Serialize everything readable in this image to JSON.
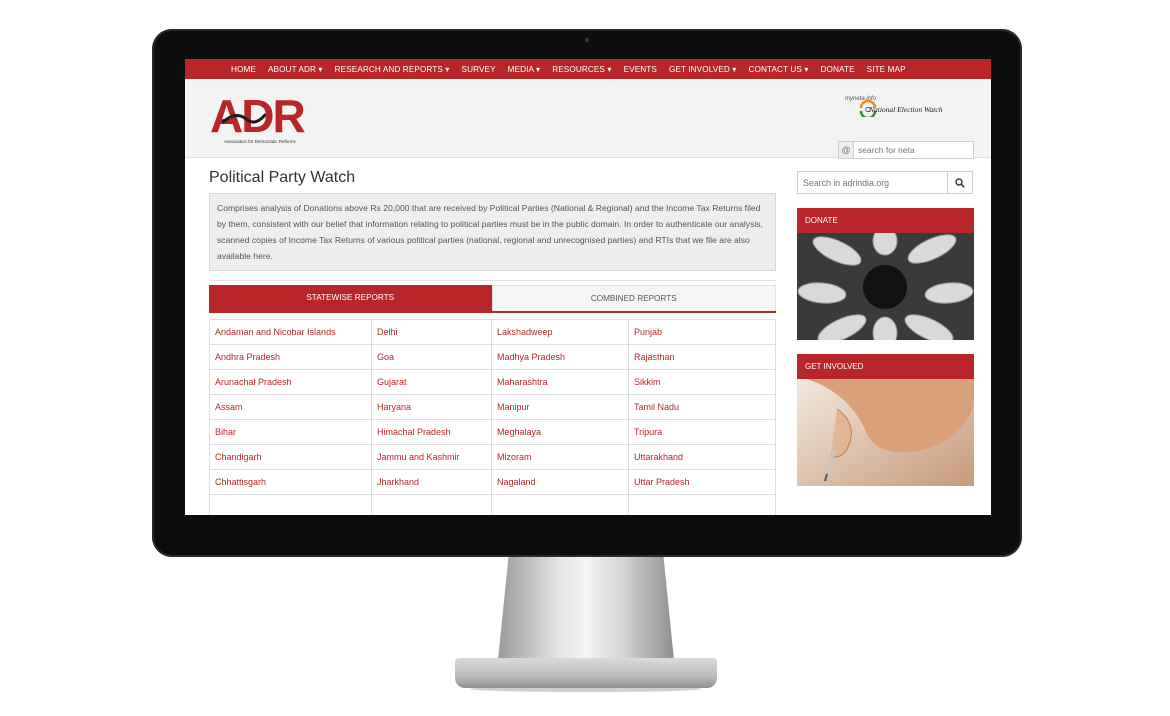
{
  "nav": {
    "items": [
      {
        "label": "HOME"
      },
      {
        "label": "ABOUT ADR ▾"
      },
      {
        "label": "RESEARCH AND REPORTS ▾"
      },
      {
        "label": "SURVEY"
      },
      {
        "label": "MEDIA ▾"
      },
      {
        "label": "RESOURCES ▾"
      },
      {
        "label": "EVENTS"
      },
      {
        "label": "GET INVOLVED ▾"
      },
      {
        "label": "CONTACT US ▾"
      },
      {
        "label": "DONATE"
      },
      {
        "label": "SITE MAP"
      }
    ]
  },
  "header": {
    "logo_text": "ADR",
    "logo_subtitle": "Association for Democratic Reforms",
    "new_logo_small": "myneta.info",
    "new_logo_text": "National Election Watch",
    "neta_search": {
      "at_symbol": "@",
      "placeholder": "search for neta"
    }
  },
  "main": {
    "title": "Political Party Watch",
    "description": "Comprises analysis of Donations above Rs 20,000 that are received by Political Parties (National & Regional) and the Income Tax Returns filed by them, consistent with our belief that information relating to political parties must be in the public domain. In order to authenticate our analysis, scanned copies of Income Tax Returns of various political parties (national, regional and unrecognised parties) and RTIs that we file are also available here.",
    "tabs": [
      {
        "label": "STATEWISE REPORTS"
      },
      {
        "label": "COMBINED REPORTS"
      }
    ],
    "states": [
      [
        "Andaman and Nicobar Islands",
        "Delhi",
        "Lakshadweep",
        "Punjab"
      ],
      [
        "Andhra Pradesh",
        "Goa",
        "Madhya Pradesh",
        "Rajasthan"
      ],
      [
        "Arunachal Pradesh",
        "Gujarat",
        "Maharashtra",
        "Sikkim"
      ],
      [
        "Assam",
        "Haryana",
        "Manipur",
        "Tamil Nadu"
      ],
      [
        "Bihar",
        "Himachal Pradesh",
        "Meghalaya",
        "Tripura"
      ],
      [
        "Chandigarh",
        "Jammu and Kashmir",
        "Mizoram",
        "Uttarakhand"
      ],
      [
        "Chhattisgarh",
        "Jharkhand",
        "Nagaland",
        "Uttar Pradesh"
      ],
      [
        "",
        "",
        "",
        ""
      ]
    ]
  },
  "sidebar": {
    "search": {
      "placeholder": "Search in adrindia.org",
      "icon": "search-icon"
    },
    "widgets": [
      {
        "title": "DONATE"
      },
      {
        "title": "GET INVOLVED"
      }
    ]
  },
  "colors": {
    "accent": "#b8262a",
    "header_bg": "#f3f3f3",
    "desc_bg": "#eeeeee"
  }
}
